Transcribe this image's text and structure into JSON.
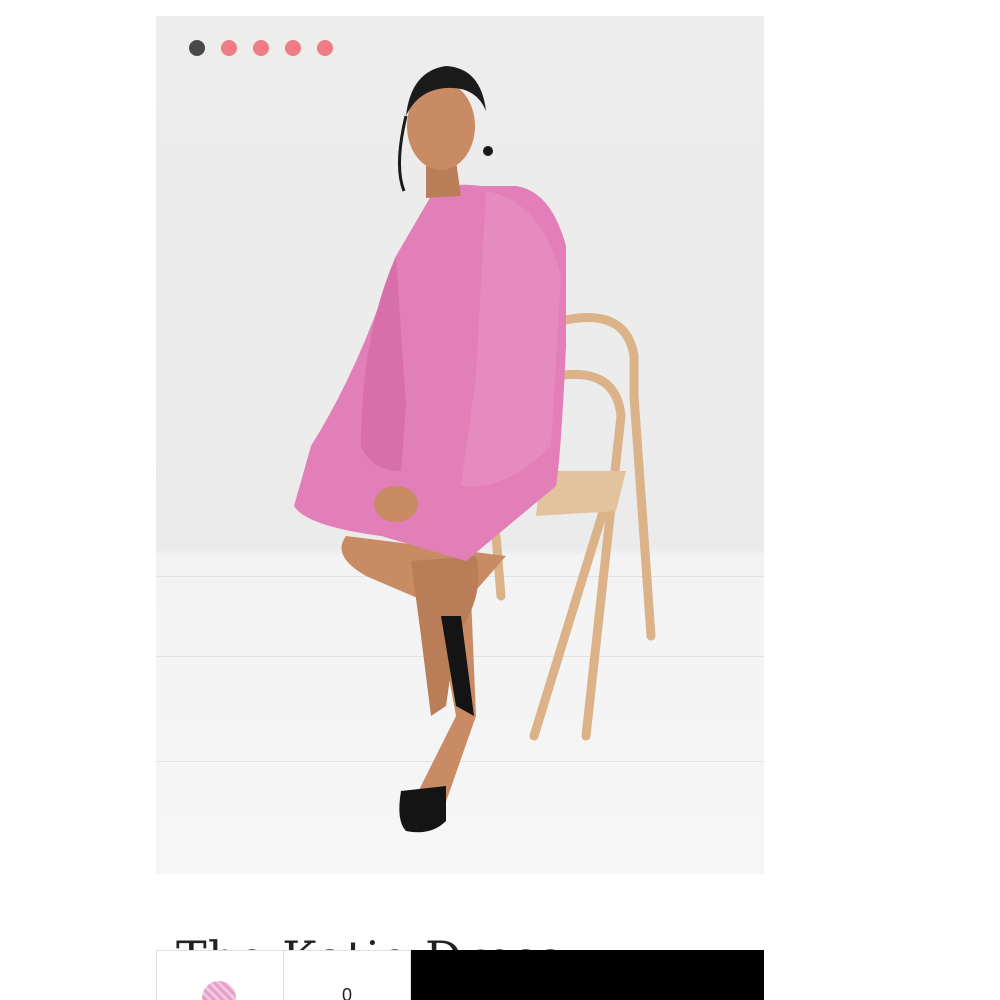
{
  "gallery": {
    "active_index": 0,
    "dots": [
      "",
      "",
      "",
      "",
      ""
    ],
    "image_alt": "Model wearing The Katie Dress seated on a wooden chair"
  },
  "product": {
    "title": "The Katie Dress"
  },
  "purchase_bar": {
    "swatch_name": "pink gingham",
    "quantity": "0",
    "add_label": ""
  },
  "colors": {
    "dot_active": "#4a4a4a",
    "dot_inactive": "#f07c85",
    "dress": "#e27fb8",
    "button": "#000000"
  }
}
